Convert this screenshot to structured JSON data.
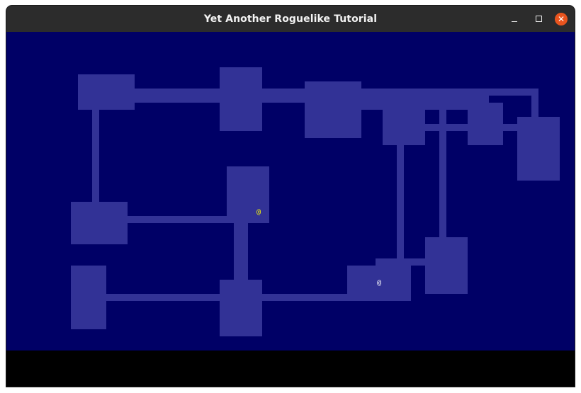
{
  "window": {
    "title": "Yet Another Roguelike Tutorial",
    "controls": {
      "minimize": "minimize",
      "maximize": "maximize",
      "close": "✕"
    }
  },
  "map": {
    "background_color": "#000066",
    "floor_color": "#323296",
    "player": {
      "glyph": "@",
      "color": "#ffffff"
    },
    "npc": {
      "glyph": "@",
      "color": "#ffff00"
    }
  },
  "status_bar": {
    "background_color": "#000000"
  }
}
